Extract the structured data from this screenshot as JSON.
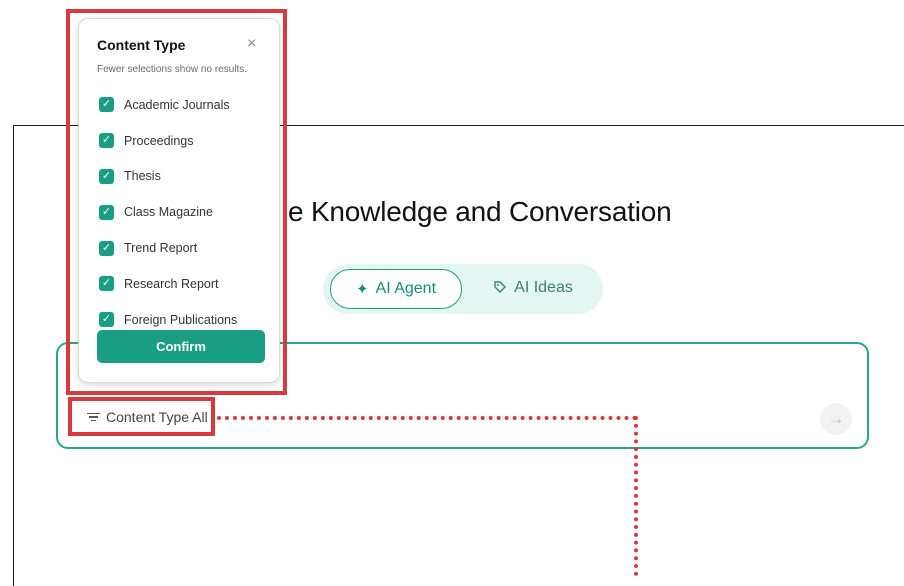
{
  "headline": "e Knowledge and Conversation",
  "mode_toggle": {
    "active_label": "AI Agent",
    "inactive_label": "AI Ideas"
  },
  "filter": {
    "label": "Content Type All"
  },
  "send_button": {
    "glyph": "→"
  },
  "panel": {
    "title": "Content Type",
    "close": "×",
    "note": "Fewer selections show no results.",
    "options": [
      {
        "label": "Academic Journals",
        "checked": true
      },
      {
        "label": "Proceedings",
        "checked": true
      },
      {
        "label": "Thesis",
        "checked": true
      },
      {
        "label": "Class Magazine",
        "checked": true
      },
      {
        "label": "Trend Report",
        "checked": true
      },
      {
        "label": "Research Report",
        "checked": true
      },
      {
        "label": "Foreign Publications",
        "checked": true
      }
    ],
    "confirm_label": "Confirm"
  },
  "icons": {
    "agent": "sparkle-icon",
    "ideas": "tag-icon",
    "filter": "filter-lines-icon",
    "check": "checkmark-icon",
    "send": "arrow-right-icon"
  },
  "colors": {
    "accent": "#1a9e83",
    "toggle_bg": "#e3f6f1",
    "highlight": "#d63a3f"
  }
}
